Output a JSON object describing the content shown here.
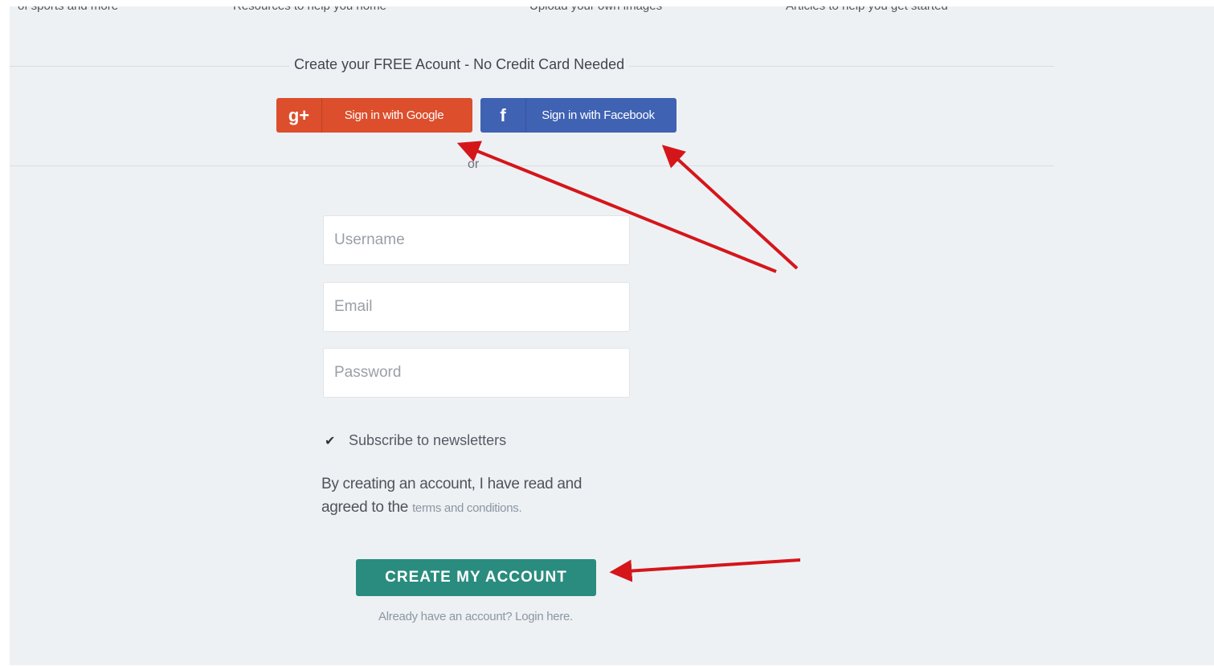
{
  "top_strip": {
    "items": [
      "of sports and more",
      "Resources to help you home",
      "Upload your own images",
      "Articles to help you get started"
    ]
  },
  "signup": {
    "title": "Create your FREE Acount - No Credit Card Needed",
    "google_icon": "g+",
    "google_label": "Sign in with Google",
    "facebook_icon": "f",
    "facebook_label": "Sign in with Facebook",
    "or_label": "or"
  },
  "form": {
    "username_placeholder": "Username",
    "email_placeholder": "Email",
    "password_placeholder": "Password",
    "subscribe_label": "Subscribe to newsletters",
    "subscribe_checked": true,
    "terms_text": "By creating an account, I have read and agreed to the",
    "terms_link": "terms and conditions.",
    "create_button": "CREATE MY ACCOUNT",
    "login_link": "Already have an account? Login here."
  },
  "icons": {
    "checkmark": "check-icon",
    "google": "google-plus-icon",
    "facebook": "facebook-icon"
  },
  "colors": {
    "google": "#dc4e2c",
    "facebook": "#3f62b3",
    "create_button": "#2a8c7e",
    "annotation_arrow": "#d4161b",
    "page_background": "#eef1f4"
  }
}
